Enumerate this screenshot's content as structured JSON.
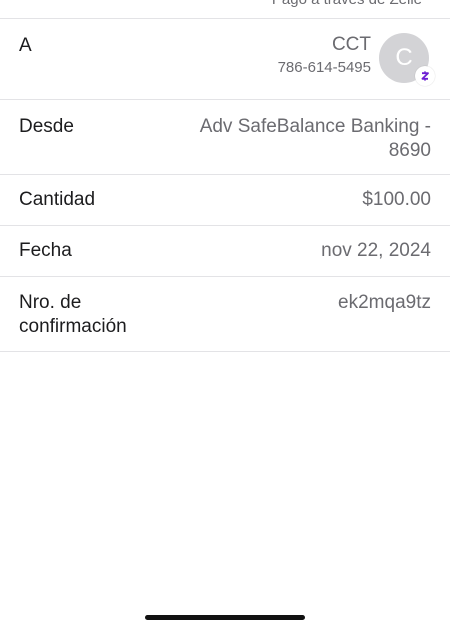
{
  "header": {
    "truncated_text": "Pago a través de Zelle"
  },
  "recipient": {
    "label": "A",
    "name": "CCT",
    "phone": "786-614-5495",
    "avatar_initial": "C",
    "badge_icon": "zelle-icon",
    "badge_color": "#6d1ed4"
  },
  "from": {
    "label": "Desde",
    "value": "Adv SafeBalance Banking - 8690"
  },
  "amount": {
    "label": "Cantidad",
    "value": "$100.00"
  },
  "date": {
    "label": "Fecha",
    "value": "nov 22, 2024"
  },
  "confirmation": {
    "label": "Nro. de confirmación",
    "value": "ek2mqa9tz"
  }
}
